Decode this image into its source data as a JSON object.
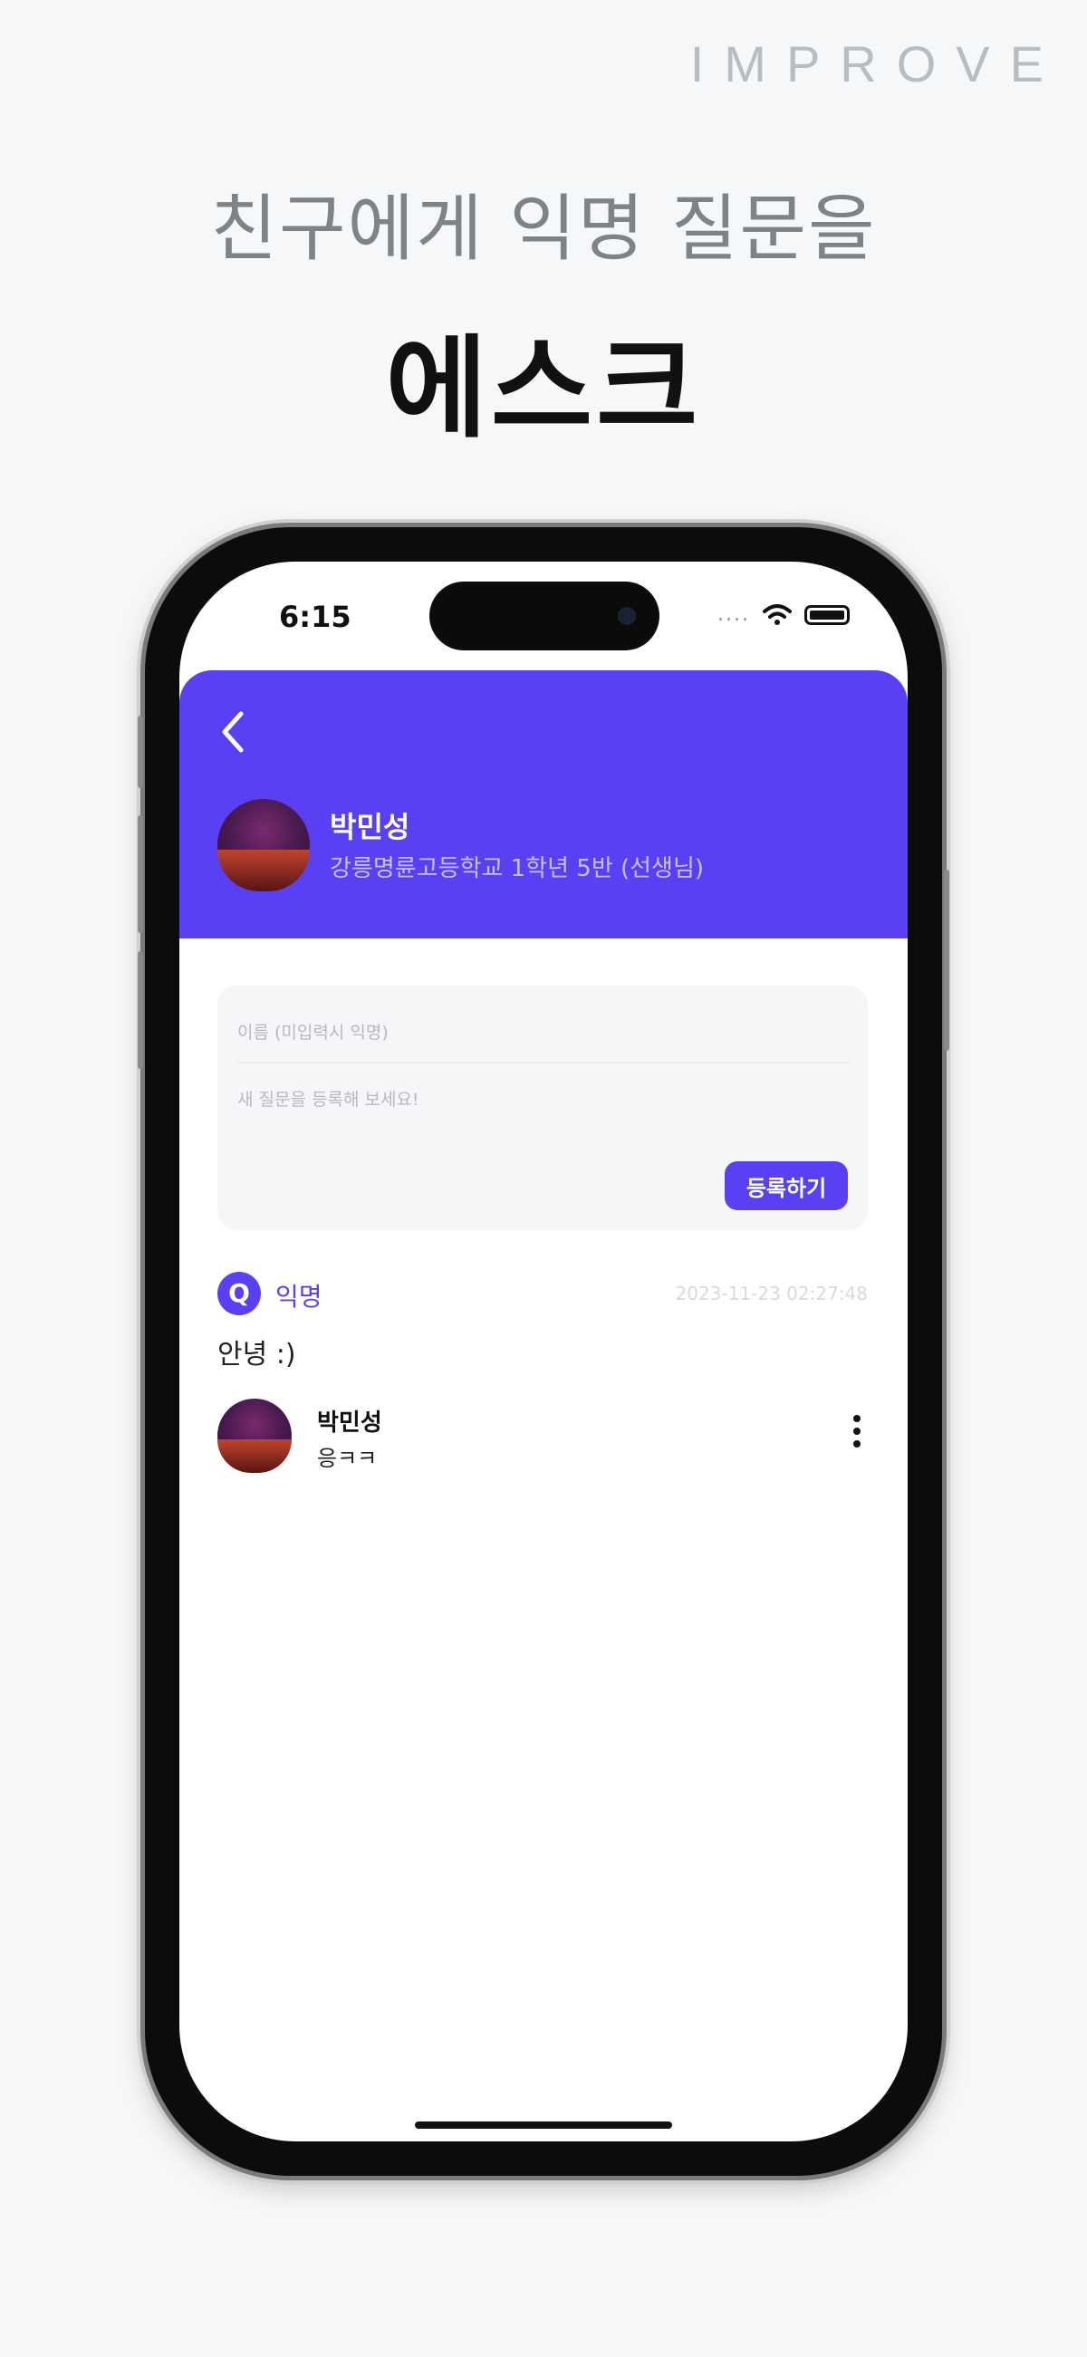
{
  "brand": "IMPROVE",
  "headline": {
    "sub": "친구에게 익명 질문을",
    "main": "에스크"
  },
  "status_bar": {
    "time": "6:15",
    "signal": "....",
    "icons": [
      "wifi-icon",
      "battery-icon"
    ]
  },
  "profile": {
    "name": "박민성",
    "school": "강릉명륜고등학교 1학년 5반 (선생님)",
    "colors": {
      "header": "#5a40f5"
    }
  },
  "question_form": {
    "name_placeholder": "이름 (미입력시 익명)",
    "question_placeholder": "새 질문을 등록해 보세요!",
    "submit_label": "등록하기"
  },
  "questions": [
    {
      "badge": "Q",
      "author": "익명",
      "date": "2023-11-23 02:27:48",
      "text": "안녕 :)",
      "reply": {
        "name": "박민성",
        "text": "응ㅋㅋ"
      }
    }
  ]
}
